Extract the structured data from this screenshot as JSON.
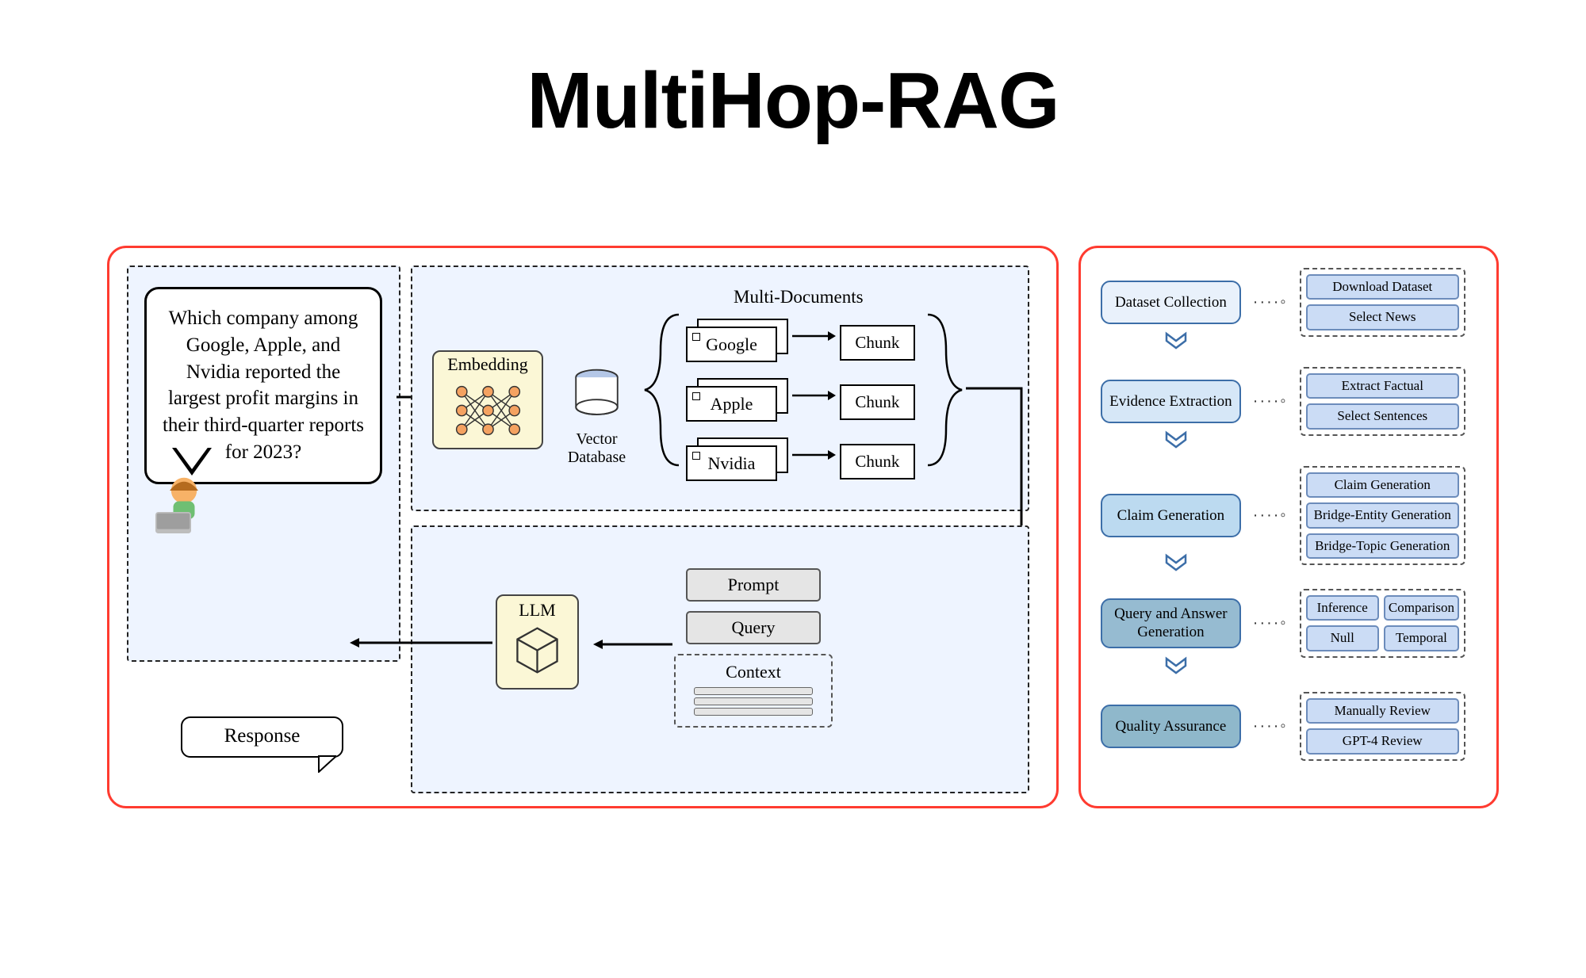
{
  "title": "MultiHop-RAG",
  "query_bubble": "Which company among Google, Apple, and Nvidia reported the largest profit margins in their third-quarter reports for 2023?",
  "embedding_label": "Embedding",
  "vector_db_label": "Vector Database",
  "multi_docs_label": "Multi-Documents",
  "docs": [
    {
      "name": "Google",
      "chunk": "Chunk"
    },
    {
      "name": "Apple",
      "chunk": "Chunk"
    },
    {
      "name": "Nvidia",
      "chunk": "Chunk"
    }
  ],
  "llm_label": "LLM",
  "context_items": {
    "prompt": "Prompt",
    "query": "Query",
    "context": "Context"
  },
  "response_label": "Response",
  "pipeline": [
    {
      "label": "Dataset Collection",
      "subs": [
        "Download Dataset",
        "Select News"
      ]
    },
    {
      "label": "Evidence Extraction",
      "subs": [
        "Extract Factual",
        "Select Sentences"
      ]
    },
    {
      "label": "Claim Generation",
      "subs": [
        "Claim Generation",
        "Bridge-Entity Generation",
        "Bridge-Topic Generation"
      ]
    },
    {
      "label": "Query and Answer Generation",
      "subs": [
        "Inference",
        "Comparison",
        "Null",
        "Temporal"
      ]
    },
    {
      "label": "Quality Assurance",
      "subs": [
        "Manually Review",
        "GPT-4 Review"
      ]
    }
  ]
}
